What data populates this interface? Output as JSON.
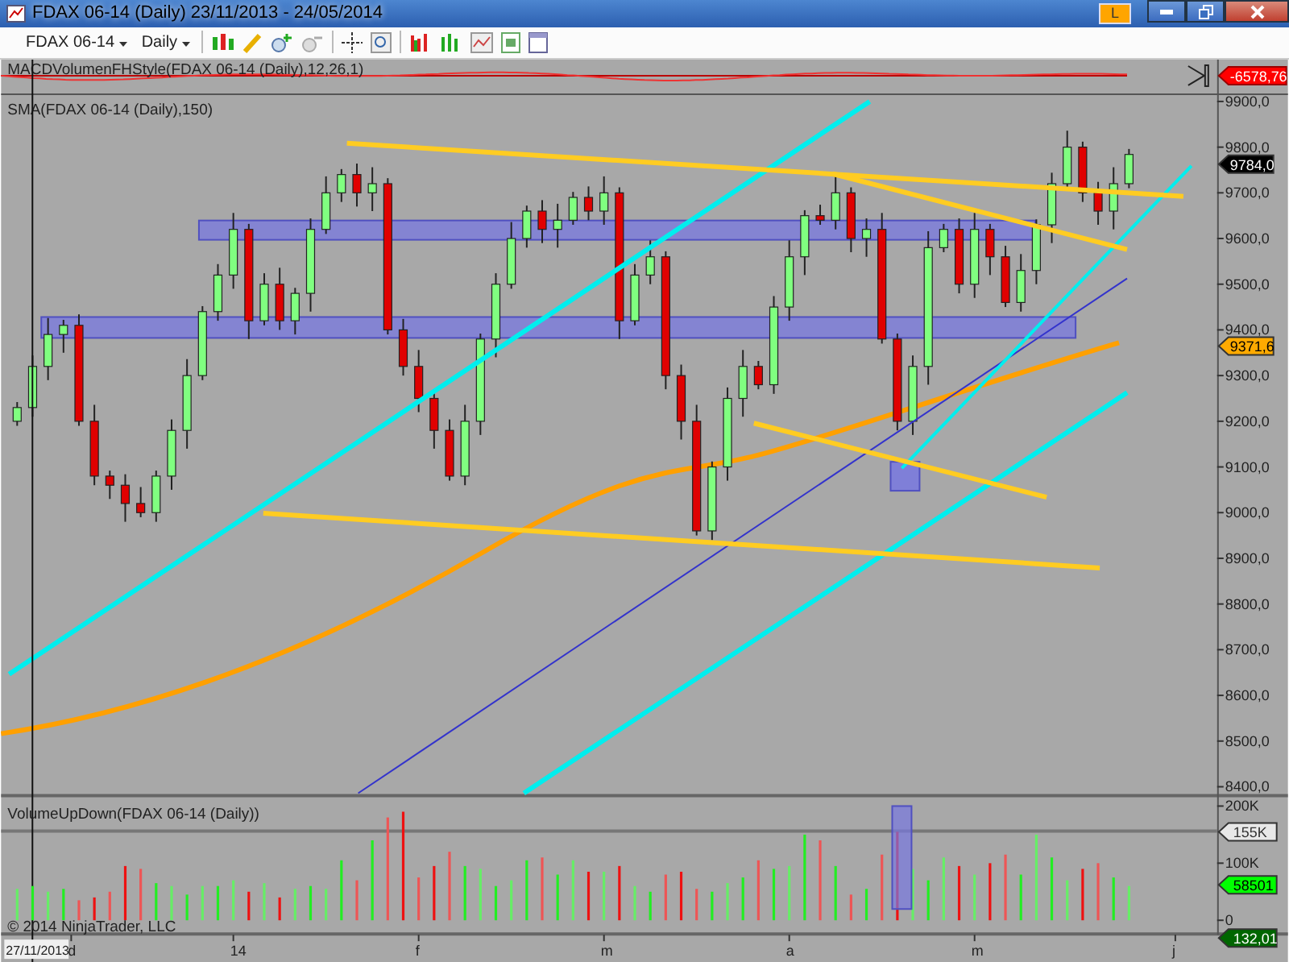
{
  "window": {
    "title": "FDAX 06-14 (Daily)  23/11/2013 - 24/05/2014",
    "indicator_button": "L"
  },
  "toolbar": {
    "instrument": "FDAX 06-14",
    "interval": "Daily"
  },
  "macd_panel": {
    "label": "MACDVolumenFHStyle(FDAX 06-14 (Daily),12,26,1)",
    "marker": "-6578,76"
  },
  "price_panel": {
    "label": "SMA(FDAX 06-14 (Daily),150)",
    "markers": [
      {
        "text": "9784,0",
        "kind": "last"
      },
      {
        "text": "9371,6",
        "kind": "sma"
      }
    ],
    "axis_labels": [
      "9900,0",
      "9800,0",
      "9700,0",
      "9600,0",
      "9500,0",
      "9400,0",
      "9300,0",
      "9200,0",
      "9100,0",
      "9000,0",
      "8900,0",
      "8800,0",
      "8700,0",
      "8600,0",
      "8500,0",
      "8400,0"
    ]
  },
  "volume_panel": {
    "label": "VolumeUpDown(FDAX 06-14 (Daily))",
    "markers": [
      {
        "text": "155K",
        "kind": "line"
      },
      {
        "text": "58501",
        "kind": "volume"
      },
      {
        "text": "132,01",
        "kind": "indicator"
      }
    ],
    "axis_labels": [
      "200K",
      "100K",
      "0"
    ]
  },
  "copyright": "© 2014 NinjaTrader, LLC",
  "x_axis": {
    "start_date": "27/11/2013",
    "labels": [
      "d",
      "14",
      "f",
      "m",
      "a",
      "m",
      "j"
    ]
  }
}
